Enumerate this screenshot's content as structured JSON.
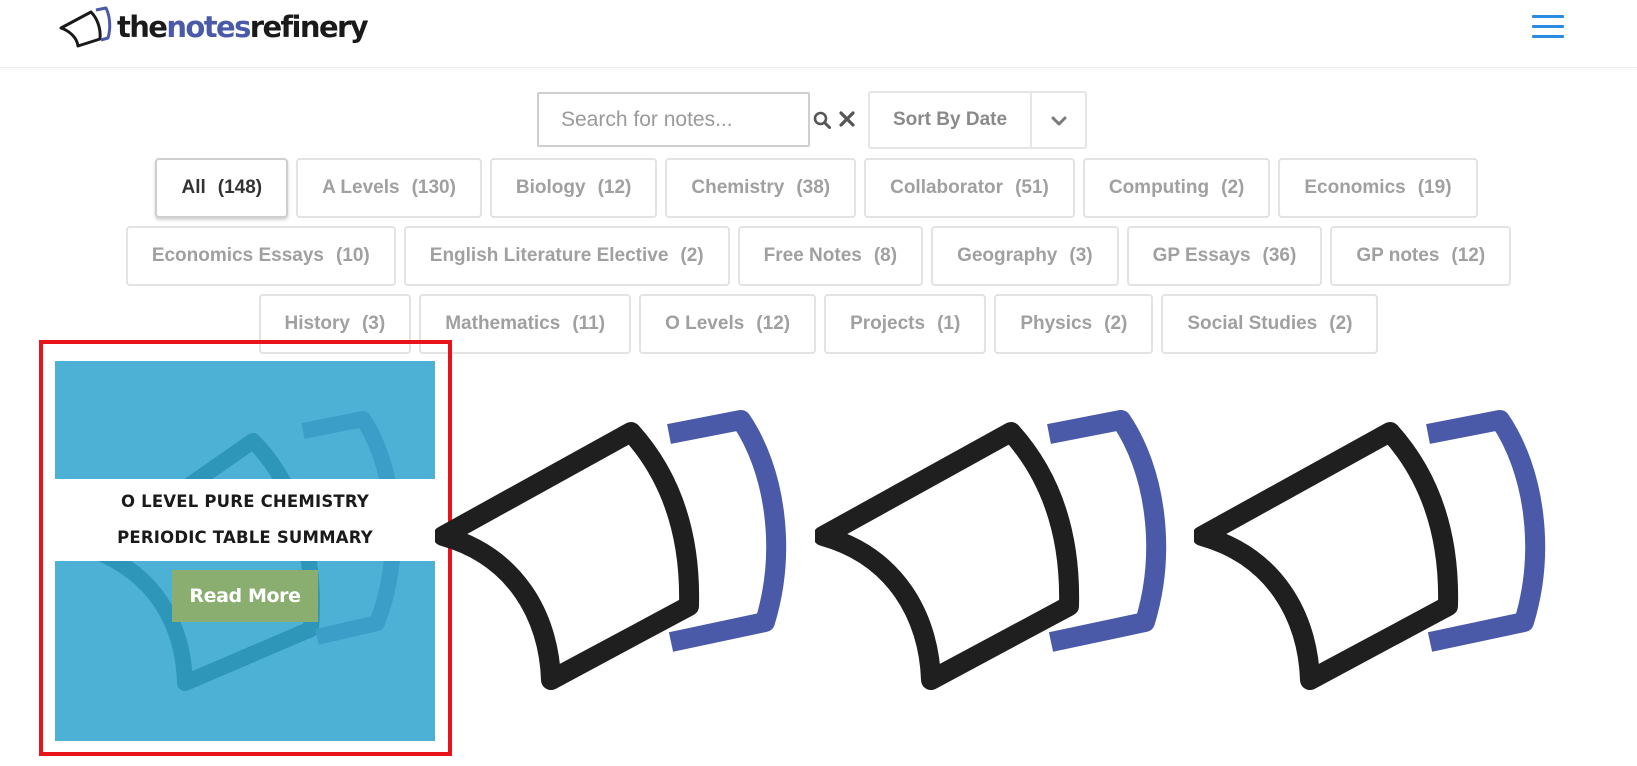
{
  "site": {
    "logo_dark": "the",
    "logo_accent": "notes",
    "logo_dark2": "refinery"
  },
  "search": {
    "placeholder": "Search for notes...",
    "value": ""
  },
  "sort": {
    "label": "Sort By Date"
  },
  "filters": [
    [
      {
        "label": "All",
        "count": "(148)",
        "active": true
      },
      {
        "label": "A Levels",
        "count": "(130)"
      },
      {
        "label": "Biology",
        "count": "(12)"
      },
      {
        "label": "Chemistry",
        "count": "(38)"
      },
      {
        "label": "Collaborator",
        "count": "(51)"
      },
      {
        "label": "Computing",
        "count": "(2)"
      },
      {
        "label": "Economics",
        "count": "(19)"
      }
    ],
    [
      {
        "label": "Economics Essays",
        "count": "(10)"
      },
      {
        "label": "English Literature Elective",
        "count": "(2)"
      },
      {
        "label": "Free Notes",
        "count": "(8)"
      },
      {
        "label": "Geography",
        "count": "(3)"
      },
      {
        "label": "GP Essays",
        "count": "(36)"
      },
      {
        "label": "GP notes",
        "count": "(12)"
      }
    ],
    [
      {
        "label": "History",
        "count": "(3)"
      },
      {
        "label": "Mathematics",
        "count": "(11)"
      },
      {
        "label": "O Levels",
        "count": "(12)"
      },
      {
        "label": "Projects",
        "count": "(1)"
      },
      {
        "label": "Physics",
        "count": "(2)"
      },
      {
        "label": "Social Studies",
        "count": "(2)"
      }
    ]
  ],
  "featured_card": {
    "title": "O LEVEL PURE CHEMISTRY PERIODIC TABLE SUMMARY",
    "button_label": "Read More"
  },
  "icons": {
    "menu": "hamburger-icon",
    "search": "search-icon",
    "clear": "close-icon",
    "sort": "chevron-down-icon",
    "placeholder_thumb": "open-book-icon"
  },
  "colors": {
    "brand_blue": "#4a5aa8",
    "menu_blue": "#2b8ae2",
    "card_bg": "#4db1d5",
    "button_green": "#8aae6f",
    "highlight_red": "#e8141c"
  }
}
